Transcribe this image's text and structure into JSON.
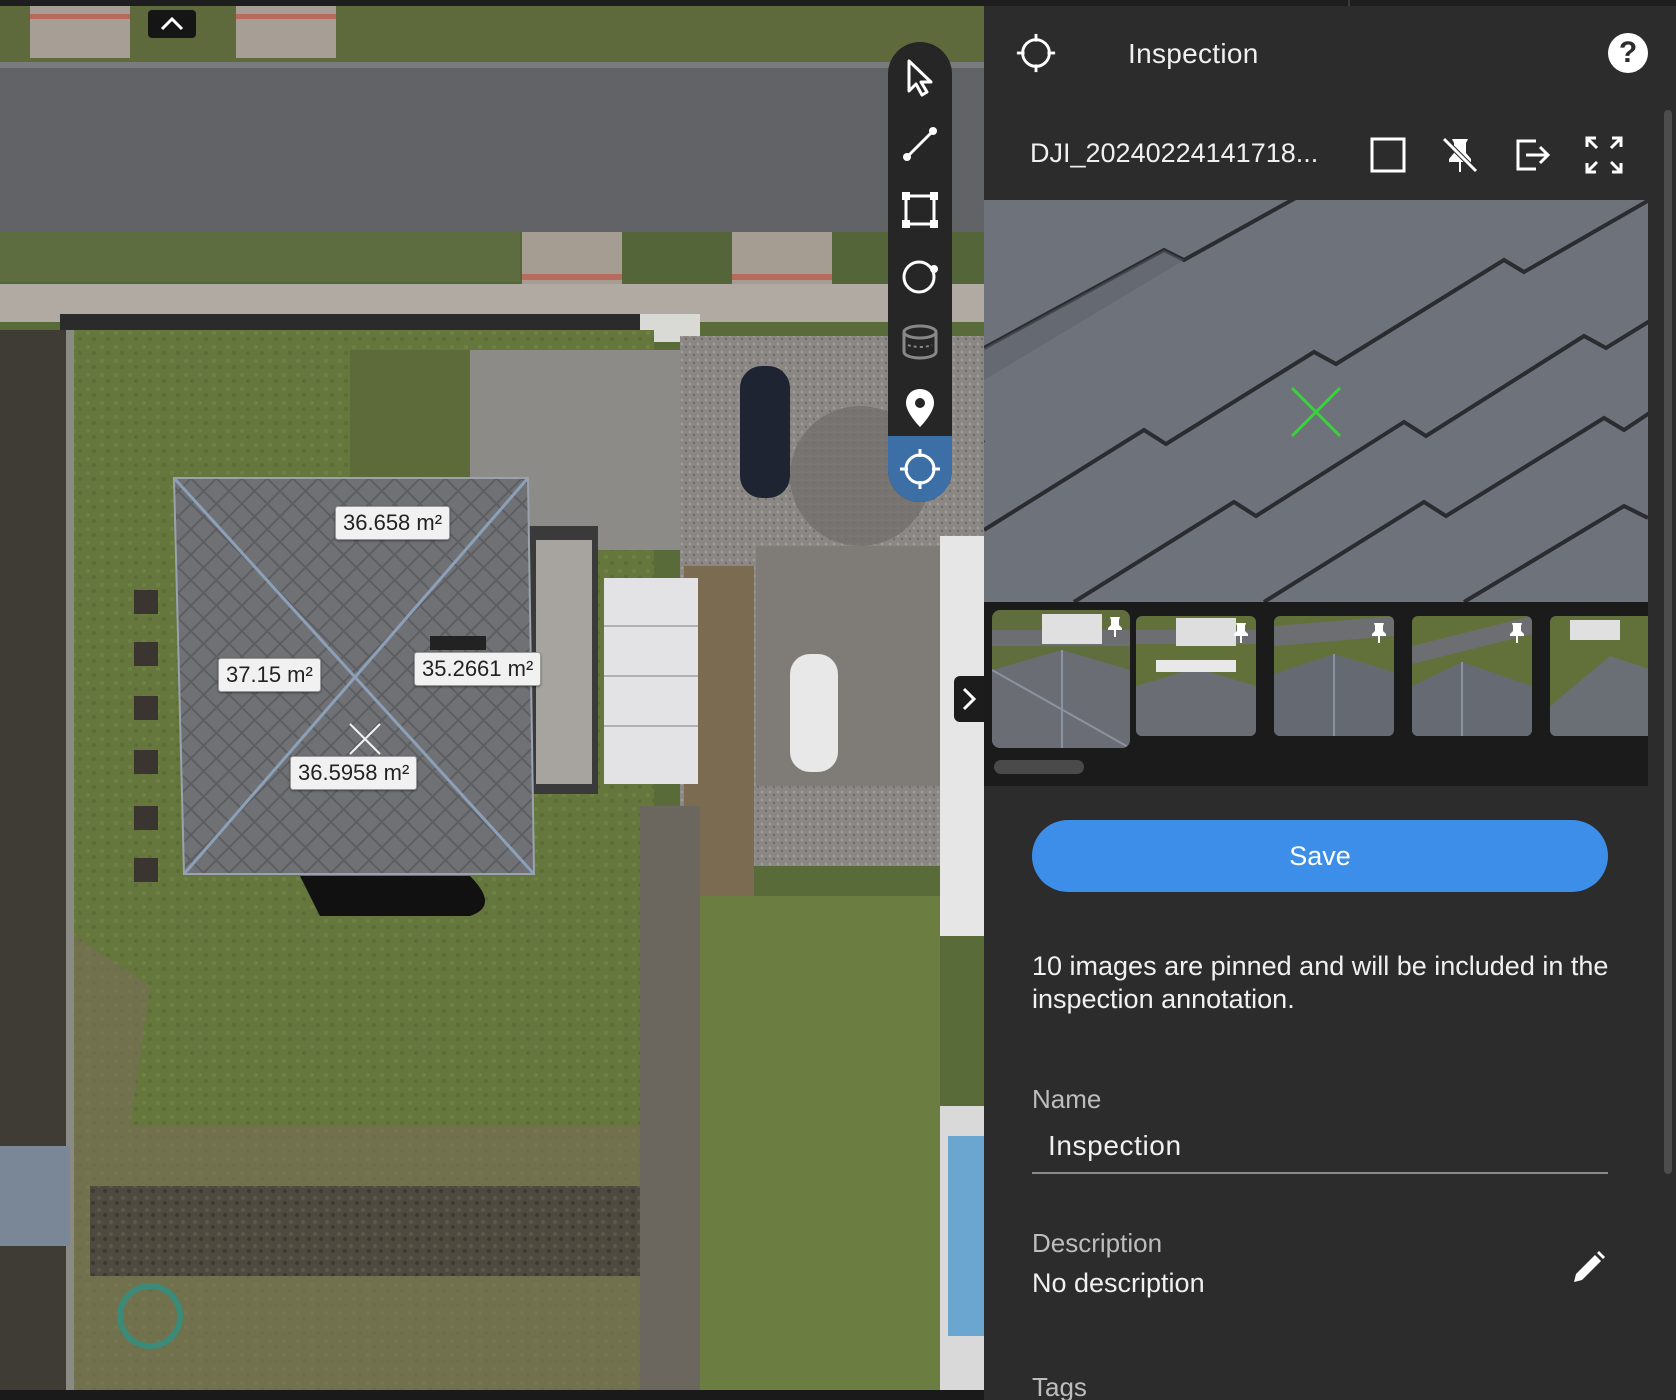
{
  "map": {
    "collapse_icon": "chevron-up-icon",
    "area_labels": [
      "36.658 m²",
      "37.15 m²",
      "35.2661 m²",
      "36.5958 m²"
    ],
    "tools": [
      {
        "name": "select-tool",
        "icon": "cursor-arrow-icon",
        "state": "normal"
      },
      {
        "name": "line-tool",
        "icon": "line-measure-icon",
        "state": "normal"
      },
      {
        "name": "area-tool",
        "icon": "polygon-area-icon",
        "state": "normal"
      },
      {
        "name": "circle-tool",
        "icon": "circle-measure-icon",
        "state": "normal"
      },
      {
        "name": "volume-tool",
        "icon": "volume-cylinder-icon",
        "state": "disabled"
      },
      {
        "name": "marker-tool",
        "icon": "location-pin-icon",
        "state": "normal"
      },
      {
        "name": "inspection-tool",
        "icon": "crosshair-icon",
        "state": "active"
      }
    ],
    "expand_icon": "chevron-right-icon"
  },
  "panel": {
    "header": {
      "icon": "crosshair-icon",
      "title": "Inspection",
      "help_label": "?"
    },
    "image": {
      "filename": "DJI_20240224141718...",
      "actions": [
        "select-square-icon",
        "unpin-icon",
        "export-icon",
        "fullscreen-icon"
      ]
    },
    "thumbnails": {
      "count_visible": 5,
      "selected_index": 0,
      "pinned": true
    },
    "save_label": "Save",
    "info_text": "10 images are pinned and will be included in the inspection annotation.",
    "name_label": "Name",
    "name_value": "Inspection",
    "description_label": "Description",
    "description_value": "No description",
    "tags_label": "Tags"
  },
  "colors": {
    "panel_bg": "#2c2c2c",
    "accent": "#3d8ee8",
    "active_tool": "#3b6fa5",
    "crosshair": "#39d23a"
  }
}
